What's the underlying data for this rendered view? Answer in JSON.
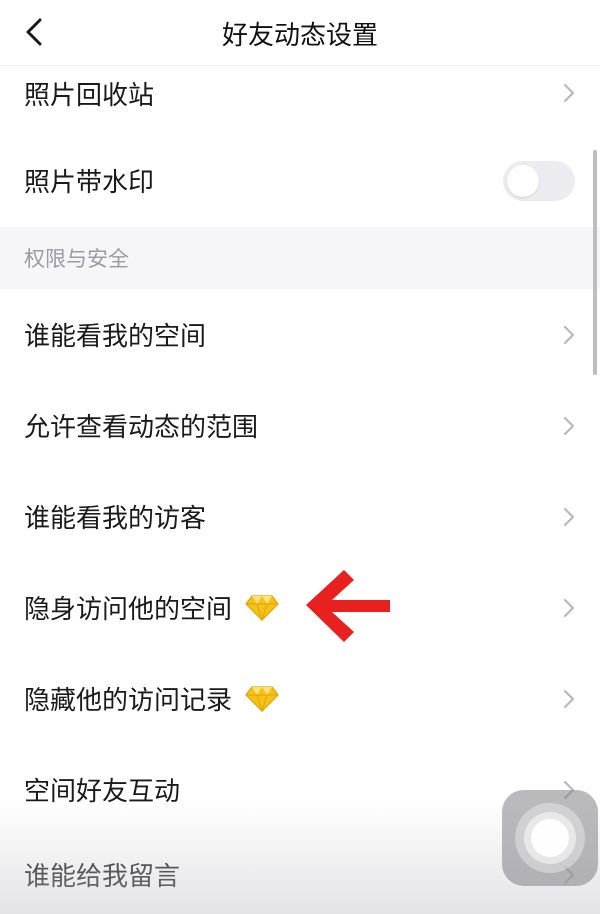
{
  "header": {
    "title": "好友动态设置",
    "back_icon": "chevron-left-icon"
  },
  "rows_top": [
    {
      "label": "照片回收站",
      "control": "chevron"
    },
    {
      "label": "照片带水印",
      "control": "toggle",
      "toggle_on": false
    }
  ],
  "section": {
    "title": "权限与安全"
  },
  "rows": [
    {
      "label": "谁能看我的空间",
      "control": "chevron"
    },
    {
      "label": "允许查看动态的范围",
      "control": "chevron"
    },
    {
      "label": "谁能看我的访客",
      "control": "chevron"
    },
    {
      "label": "隐身访问他的空间",
      "control": "chevron",
      "badge": "diamond-icon"
    },
    {
      "label": "隐藏他的访问记录",
      "control": "chevron",
      "badge": "diamond-icon"
    },
    {
      "label": "空间好友互动",
      "control": "chevron"
    },
    {
      "label": "谁能给我留言",
      "control": "chevron"
    }
  ],
  "annotation": {
    "icon": "red-arrow-icon",
    "color": "#e8201e"
  },
  "colors": {
    "section_bg": "#f6f6f9",
    "section_text": "#9a9aa3",
    "chevron": "#b8b8bd",
    "diamond": "#f6c21a"
  }
}
